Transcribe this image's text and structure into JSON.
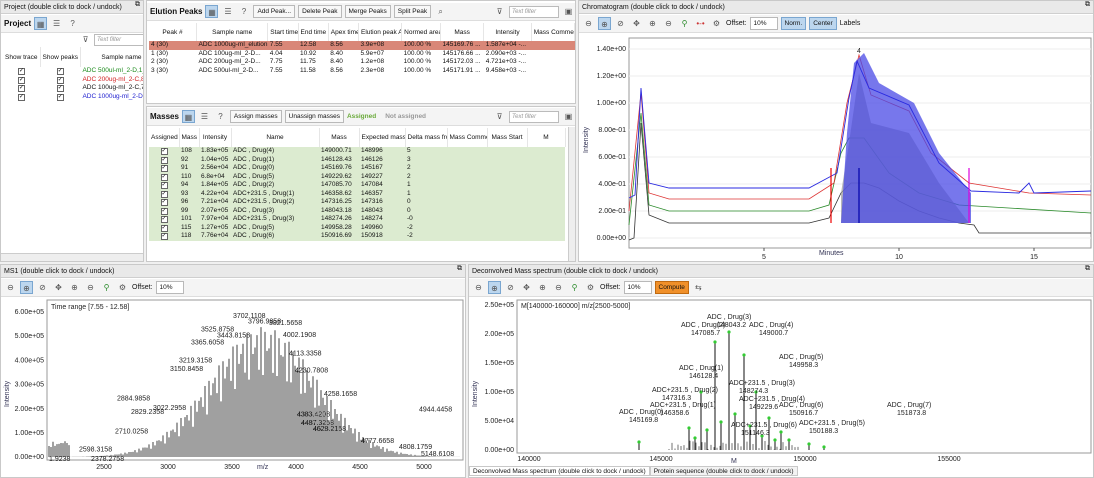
{
  "project": {
    "title": "Project (double click to dock / undock)",
    "header": "Project",
    "filter": "Text filter",
    "cols": [
      "Show trace",
      "Show peaks",
      "Sample name"
    ],
    "rows": [
      {
        "name": "ADC 500ul-ml_2-D,1_01_1",
        "color": "#1a8a1a"
      },
      {
        "name": "ADC 200ug-ml_2-C,8_01_",
        "color": "#d02020"
      },
      {
        "name": "ADC 100ug-ml_2-C,7_01_",
        "color": "#111111"
      },
      {
        "name": "ADC 1000ug-ml_2-D,2_01",
        "color": "#2020d0"
      }
    ]
  },
  "elution": {
    "header": "Elution Peaks",
    "buttons": [
      "Add Peak...",
      "Delete Peak",
      "Merge Peaks",
      "Split Peak"
    ],
    "filter": "Text filter",
    "cols": [
      "Peak #",
      "Sample name",
      "Start time",
      "End time",
      "Apex time",
      "Elution peak Area",
      "Normed area %",
      "Mass",
      "Intensity",
      "Mass Comment"
    ],
    "rows": [
      [
        "4 (30)",
        "ADC 1000ug-ml_elution...",
        "7.55",
        "12.58",
        "8.56",
        "3.9e+08",
        "100.00 %",
        "145169.76 ...",
        "1.587e+04 -..."
      ],
      [
        "1 (30)",
        "ADC 100ug-ml_2-D...",
        "4.04",
        "10.92",
        "8.40",
        "5.9e+07",
        "100.00 %",
        "145176.66 ...",
        "2.090e+03 -..."
      ],
      [
        "2 (30)",
        "ADC 200ug-ml_2-D...",
        "7.75",
        "11.75",
        "8.40",
        "1.2e+08",
        "100.00 %",
        "145172.03 ...",
        "4.721e+03 -..."
      ],
      [
        "3 (30)",
        "ADC 500ul-ml_2-D...",
        "7.55",
        "11.58",
        "8.56",
        "2.3e+08",
        "100.00 %",
        "145171.91 ...",
        "9.458e+03 -..."
      ]
    ]
  },
  "masses": {
    "header": "Masses",
    "buttons": [
      "Assign masses",
      "Unassign masses"
    ],
    "assigned": "Assigned",
    "not_assigned": "Not assigned",
    "filter": "Text filter",
    "cols": [
      "Assigned",
      "Mass Id",
      "Intensity",
      "Name",
      "Mass",
      "Expected mass",
      "Delta mass from calc.",
      "Mass Comment",
      "Mass Start",
      "M"
    ],
    "rows": [
      [
        "108",
        "1.83e+05",
        "ADC , Drug(4)",
        "149000.71",
        "148996",
        "5"
      ],
      [
        "92",
        "1.04e+05",
        "ADC , Drug(1)",
        "146128.43",
        "146126",
        "3"
      ],
      [
        "91",
        "2.56e+04",
        "ADC , Drug(0)",
        "145169.76",
        "145167",
        "2"
      ],
      [
        "110",
        "6.8e+04",
        "ADC , Drug(5)",
        "149229.62",
        "149227",
        "2"
      ],
      [
        "94",
        "1.84e+05",
        "ADC , Drug(2)",
        "147085.70",
        "147084",
        "1"
      ],
      [
        "93",
        "4.22e+04",
        "ADC+231.5 , Drug(1)",
        "146358.62",
        "146357",
        "1"
      ],
      [
        "96",
        "7.21e+04",
        "ADC+231.5 , Drug(2)",
        "147316.25",
        "147316",
        "0"
      ],
      [
        "99",
        "2.07e+05",
        "ADC , Drug(3)",
        "148043.18",
        "148043",
        "0"
      ],
      [
        "101",
        "7.97e+04",
        "ADC+231.5 , Drug(3)",
        "148274.26",
        "148274",
        "-0"
      ],
      [
        "115",
        "1.27e+05",
        "ADC , Drug(5)",
        "149958.28",
        "149960",
        "-2"
      ],
      [
        "118",
        "7.76e+04",
        "ADC , Drug(6)",
        "150916.69",
        "150918",
        "-2"
      ]
    ]
  },
  "chromatogram": {
    "title": "Chromatogram (double click to dock / undock)",
    "offset_label": "Offset:",
    "offset": "10%",
    "norm": "Norm.",
    "center": "Center",
    "labels": "Labels",
    "ylabel": "Intensity",
    "xlabel": "Minutes",
    "yticks": [
      "1.40e+00",
      "1.20e+00",
      "1.00e+00",
      "8.00e-01",
      "6.00e-01",
      "4.00e-01",
      "2.00e-01",
      "0.00e+00"
    ],
    "xticks": [
      "5",
      "10",
      "15"
    ],
    "peak_label": "4"
  },
  "ms1": {
    "title": "MS1 (double click to dock / undock)",
    "offset_label": "Offset:",
    "offset": "10%",
    "time_range": "Time range [7.55 - 12.58]",
    "ylabel": "Intensity",
    "xlabel": "m/z",
    "yticks": [
      "6.00e+05",
      "5.00e+05",
      "4.00e+05",
      "3.00e+05",
      "2.00e+05",
      "1.00e+05",
      "0.00e+00"
    ],
    "xticks": [
      "2500",
      "3000",
      "3500",
      "4000",
      "4500",
      "5000"
    ],
    "labels": [
      "3702.1108",
      "3796.9858",
      "3821.5658",
      "3525.8758",
      "3443.8158",
      "3365.6058",
      "4002.1908",
      "4113.3358",
      "3219.3158",
      "3150.8458",
      "4230.7808",
      "4258.1658",
      "2884.9858",
      "3022.2958",
      "4383.4208",
      "4487.3258",
      "4944.4458",
      "2829.2358",
      "4628.2158",
      "2710.0258",
      "4777.6658",
      "4808.1759",
      "2598.3158",
      "5148.6108",
      "1.9238",
      "2378.2758"
    ]
  },
  "decon": {
    "title": "Deconvolved Mass spectrum (double click to dock / undock)",
    "offset_label": "Offset:",
    "offset": "10%",
    "compute": "Compute",
    "range": "M[140000-160000] m/z[2500-5000]",
    "ylabel": "Intensity",
    "xlabel": "M",
    "yticks": [
      "2.50e+05",
      "2.00e+05",
      "1.50e+05",
      "1.00e+05",
      "5.00e+04",
      "0.00e+00"
    ],
    "xticks": [
      "140000",
      "145000",
      "150000",
      "155000"
    ],
    "labels": [
      {
        "n": "ADC , Drug(3)",
        "m": "148043.2"
      },
      {
        "n": "ADC , Drug(2)",
        "m": "147085.7"
      },
      {
        "n": "ADC , Drug(4)",
        "m": "149000.7"
      },
      {
        "n": "ADC , Drug(5)",
        "m": "149958.3"
      },
      {
        "n": "ADC , Drug(1)",
        "m": "146128.4"
      },
      {
        "n": "ADC+231.5 , Drug(3)",
        "m": "148274.3"
      },
      {
        "n": "ADC+231.5 , Drug(2)",
        "m": "147316.3"
      },
      {
        "n": "ADC , Drug(6)",
        "m": "150916.7"
      },
      {
        "n": "ADC+231.5 , Drug(4)",
        "m": "149229.6"
      },
      {
        "n": "ADC+231.5 , Drug(1)",
        "m": "146358.6"
      },
      {
        "n": "ADC+231.5 , Drug(5)",
        "m": "150188.3"
      },
      {
        "n": "ADC , Drug(7)",
        "m": "151873.8"
      },
      {
        "n": "ADC , Drug(0)",
        "m": "145169.8"
      },
      {
        "n": "ADC+231.5 , Drug(6)",
        "m": "151146.3"
      }
    ],
    "tabs": [
      "Deconvolved Mass spectrum (double click to dock / undock)",
      "Protein sequence (double click to dock / undock)"
    ]
  }
}
